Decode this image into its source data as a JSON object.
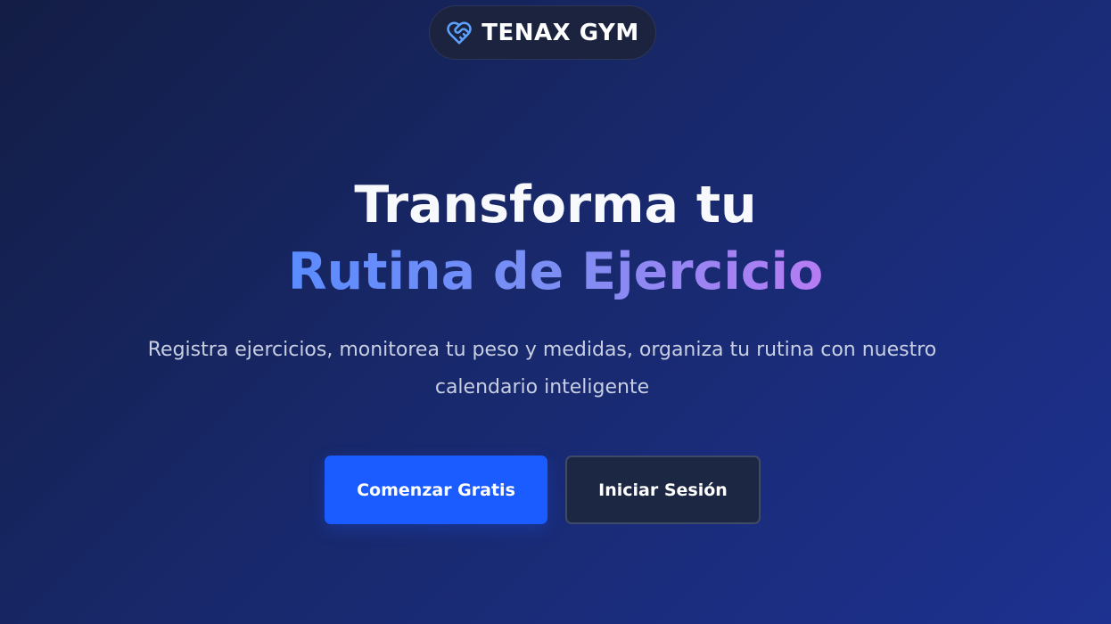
{
  "brand": {
    "icon": "heart-handshake-icon",
    "name": "TENAX GYM"
  },
  "hero": {
    "title_line1": "Transforma tu",
    "title_line2": "Rutina de Ejercicio",
    "subtitle_line1": "Registra ejercicios, monitorea tu peso y medidas, organiza tu rutina con nuestro",
    "subtitle_line2": "calendario inteligente"
  },
  "actions": {
    "primary_label": "Comenzar Gratis",
    "secondary_label": "Iniciar Sesión"
  },
  "colors": {
    "background_start": "#131d45",
    "background_end": "#1d3190",
    "accent": "#1a5cff",
    "gradient_start": "#5b8cff",
    "gradient_end": "#b67cf3"
  }
}
